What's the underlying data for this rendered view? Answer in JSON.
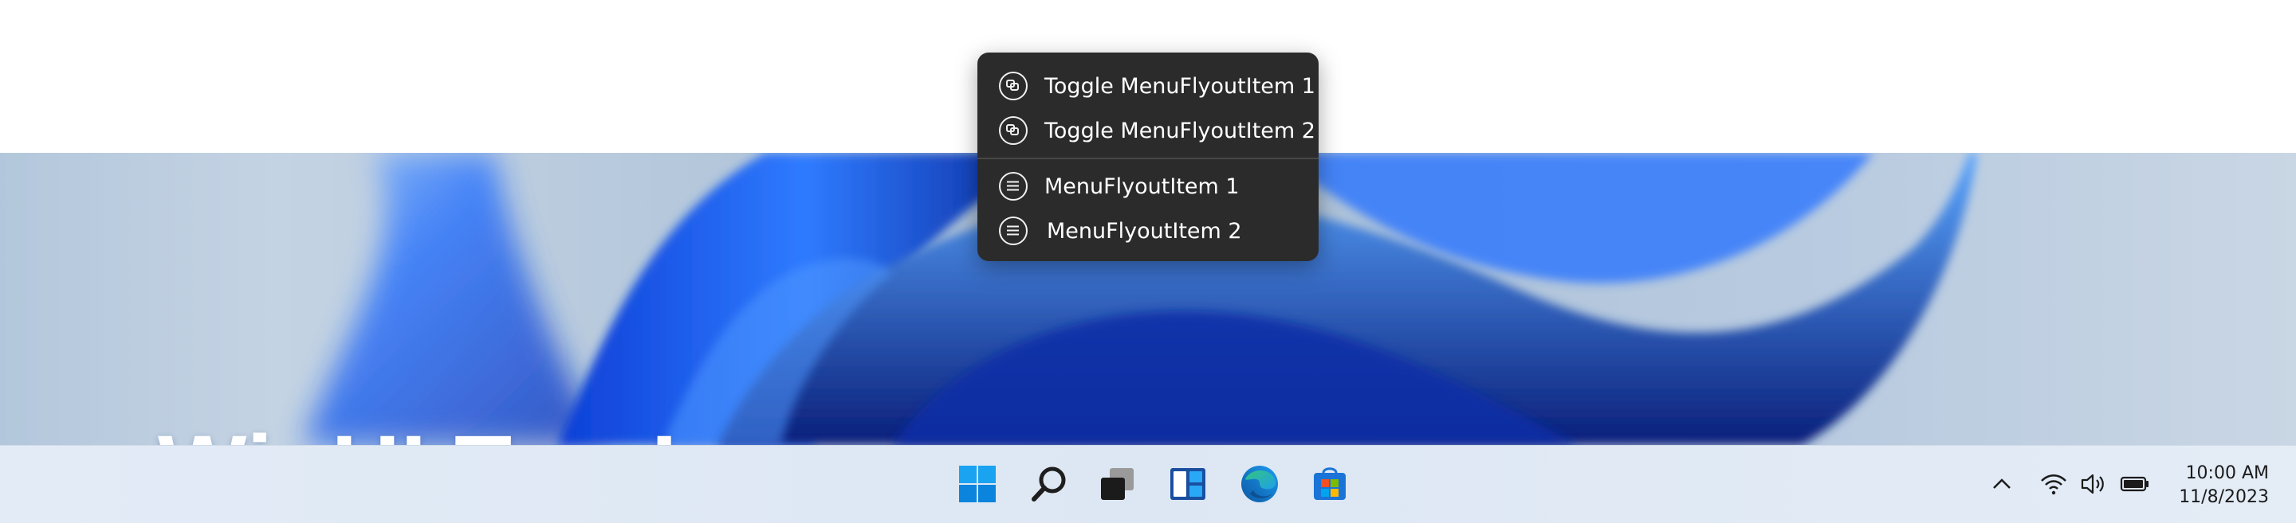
{
  "desktop": {
    "hero_title": "WinUI TrayIcon"
  },
  "context_menu": {
    "items": [
      {
        "label": "Toggle MenuFlyoutItem 1",
        "icon": "toggle-icon"
      },
      {
        "label": "Toggle MenuFlyoutItem 2",
        "icon": "toggle-icon"
      },
      {
        "label": "MenuFlyoutItem 1",
        "icon": "list-icon"
      },
      {
        "label": "MenuFlyoutItem 2",
        "icon": "list-icon"
      }
    ]
  },
  "taskbar": {
    "apps": [
      {
        "name": "start",
        "icon": "windows-logo-icon"
      },
      {
        "name": "search",
        "icon": "search-icon"
      },
      {
        "name": "task-view",
        "icon": "task-view-icon"
      },
      {
        "name": "widgets",
        "icon": "widgets-icon"
      },
      {
        "name": "edge",
        "icon": "edge-icon"
      },
      {
        "name": "store",
        "icon": "store-icon"
      }
    ],
    "tray": {
      "icons": [
        "chevron-up-icon",
        "wifi-icon",
        "volume-icon",
        "battery-icon"
      ],
      "time": "10:00 AM",
      "date": "11/8/2023"
    },
    "accent_color": "#0078d4"
  }
}
